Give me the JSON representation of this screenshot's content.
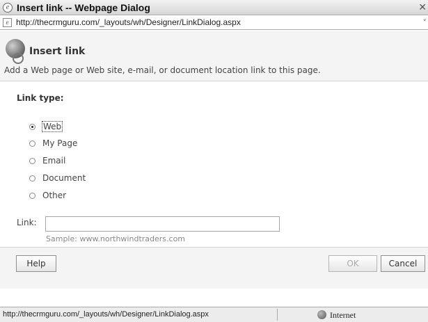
{
  "window": {
    "title": "Insert link -- Webpage Dialog",
    "url": "http://thecrmguru.com/_layouts/wh/Designer/LinkDialog.aspx",
    "close_glyph": "✕",
    "dropdown_glyph": "˅"
  },
  "header": {
    "title": "Insert link",
    "description": "Add a Web page or Web site, e-mail, or document location link to this page."
  },
  "link_type": {
    "label": "Link type:",
    "options": [
      {
        "label": "Web",
        "checked": true
      },
      {
        "label": "My Page",
        "checked": false
      },
      {
        "label": "Email",
        "checked": false
      },
      {
        "label": "Document",
        "checked": false
      },
      {
        "label": "Other",
        "checked": false
      }
    ]
  },
  "link_field": {
    "label": "Link:",
    "value": "",
    "sample": "Sample: www.northwindtraders.com"
  },
  "buttons": {
    "help": "Help",
    "ok": "OK",
    "cancel": "Cancel"
  },
  "status": {
    "url": "http://thecrmguru.com/_layouts/wh/Designer/LinkDialog.aspx",
    "zone": "Internet"
  }
}
